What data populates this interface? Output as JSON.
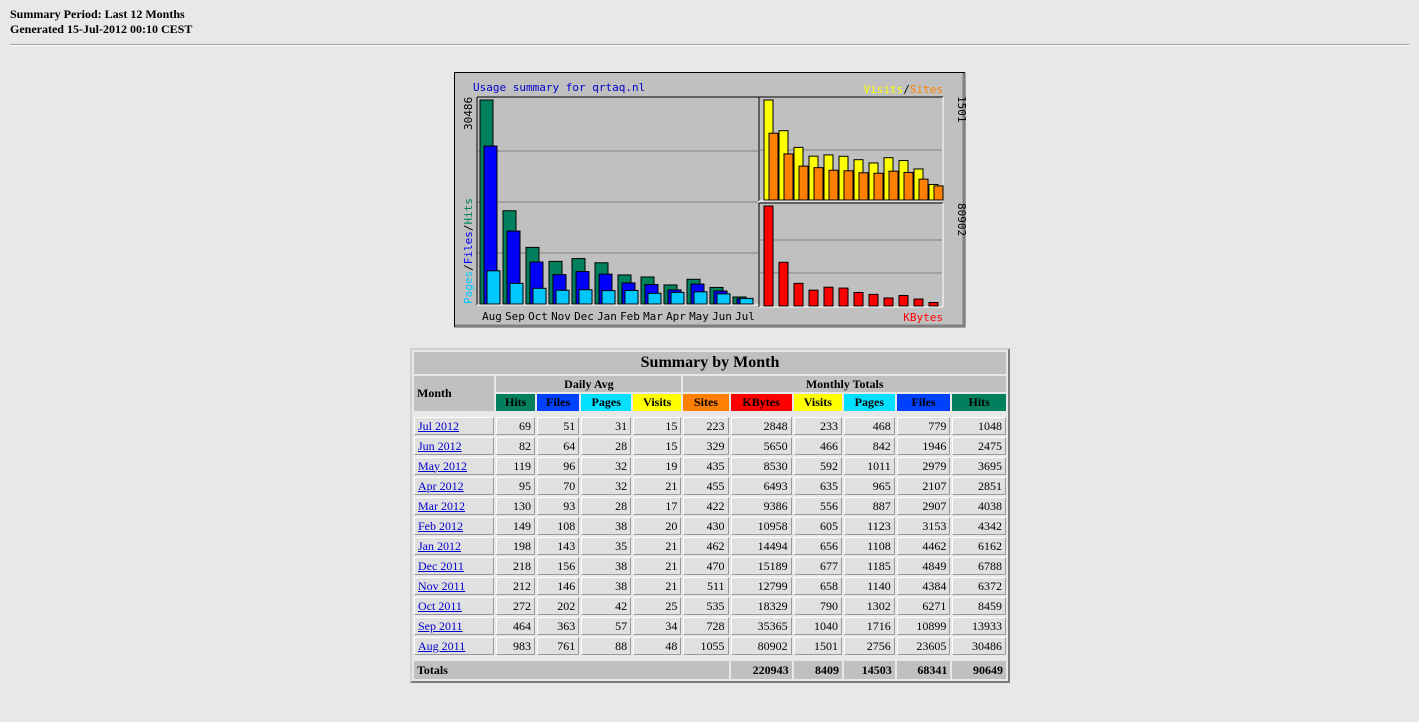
{
  "header": {
    "period": "Summary Period: Last 12 Months",
    "generated": "Generated 15-Jul-2012 00:10 CEST"
  },
  "graph": {
    "title": "Usage summary for qrtaq.nl",
    "left_axis_max": "30486",
    "left_legend": {
      "pages": "Pages",
      "files": "Files",
      "hits": "Hits",
      "sep": "/"
    },
    "visits_legend": "Visits",
    "sites_legend": "Sites",
    "visits_axis_max": "1501",
    "kbytes_axis_max": "80902",
    "kbytes_legend": "KBytes",
    "months": [
      "Aug",
      "Sep",
      "Oct",
      "Nov",
      "Dec",
      "Jan",
      "Feb",
      "Mar",
      "Apr",
      "May",
      "Jun",
      "Jul"
    ],
    "colors": {
      "hits": "#00805c",
      "files": "#0000ff",
      "pages": "#00c8ff",
      "visits": "#ffff00",
      "sites": "#ff8000",
      "kbytes": "#ff0000",
      "plot_bg": "#c0c0c0",
      "title": "#0000cc"
    }
  },
  "table": {
    "title": "Summary by Month",
    "month_header": "Month",
    "daily_avg_header": "Daily Avg",
    "monthly_totals_header": "Monthly Totals",
    "daily_cols": [
      "Hits",
      "Files",
      "Pages",
      "Visits"
    ],
    "monthly_cols": [
      "Sites",
      "KBytes",
      "Visits",
      "Pages",
      "Files",
      "Hits"
    ],
    "rows": [
      {
        "month": "Jul 2012",
        "d_hits": "69",
        "d_files": "51",
        "d_pages": "31",
        "d_visits": "15",
        "sites": "223",
        "kbytes": "2848",
        "visits": "233",
        "pages": "468",
        "files": "779",
        "hits": "1048"
      },
      {
        "month": "Jun 2012",
        "d_hits": "82",
        "d_files": "64",
        "d_pages": "28",
        "d_visits": "15",
        "sites": "329",
        "kbytes": "5650",
        "visits": "466",
        "pages": "842",
        "files": "1946",
        "hits": "2475"
      },
      {
        "month": "May 2012",
        "d_hits": "119",
        "d_files": "96",
        "d_pages": "32",
        "d_visits": "19",
        "sites": "435",
        "kbytes": "8530",
        "visits": "592",
        "pages": "1011",
        "files": "2979",
        "hits": "3695"
      },
      {
        "month": "Apr 2012",
        "d_hits": "95",
        "d_files": "70",
        "d_pages": "32",
        "d_visits": "21",
        "sites": "455",
        "kbytes": "6493",
        "visits": "635",
        "pages": "965",
        "files": "2107",
        "hits": "2851"
      },
      {
        "month": "Mar 2012",
        "d_hits": "130",
        "d_files": "93",
        "d_pages": "28",
        "d_visits": "17",
        "sites": "422",
        "kbytes": "9386",
        "visits": "556",
        "pages": "887",
        "files": "2907",
        "hits": "4038"
      },
      {
        "month": "Feb 2012",
        "d_hits": "149",
        "d_files": "108",
        "d_pages": "38",
        "d_visits": "20",
        "sites": "430",
        "kbytes": "10958",
        "visits": "605",
        "pages": "1123",
        "files": "3153",
        "hits": "4342"
      },
      {
        "month": "Jan 2012",
        "d_hits": "198",
        "d_files": "143",
        "d_pages": "35",
        "d_visits": "21",
        "sites": "462",
        "kbytes": "14494",
        "visits": "656",
        "pages": "1108",
        "files": "4462",
        "hits": "6162"
      },
      {
        "month": "Dec 2011",
        "d_hits": "218",
        "d_files": "156",
        "d_pages": "38",
        "d_visits": "21",
        "sites": "470",
        "kbytes": "15189",
        "visits": "677",
        "pages": "1185",
        "files": "4849",
        "hits": "6788"
      },
      {
        "month": "Nov 2011",
        "d_hits": "212",
        "d_files": "146",
        "d_pages": "38",
        "d_visits": "21",
        "sites": "511",
        "kbytes": "12799",
        "visits": "658",
        "pages": "1140",
        "files": "4384",
        "hits": "6372"
      },
      {
        "month": "Oct 2011",
        "d_hits": "272",
        "d_files": "202",
        "d_pages": "42",
        "d_visits": "25",
        "sites": "535",
        "kbytes": "18329",
        "visits": "790",
        "pages": "1302",
        "files": "6271",
        "hits": "8459"
      },
      {
        "month": "Sep 2011",
        "d_hits": "464",
        "d_files": "363",
        "d_pages": "57",
        "d_visits": "34",
        "sites": "728",
        "kbytes": "35365",
        "visits": "1040",
        "pages": "1716",
        "files": "10899",
        "hits": "13933"
      },
      {
        "month": "Aug 2011",
        "d_hits": "983",
        "d_files": "761",
        "d_pages": "88",
        "d_visits": "48",
        "sites": "1055",
        "kbytes": "80902",
        "visits": "1501",
        "pages": "2756",
        "files": "23605",
        "hits": "30486"
      }
    ],
    "totals": {
      "label": "Totals",
      "kbytes": "220943",
      "visits": "8409",
      "pages": "14503",
      "files": "68341",
      "hits": "90649"
    }
  },
  "chart_data": {
    "type": "bar",
    "title": "Usage summary for qrtaq.nl",
    "categories": [
      "Aug",
      "Sep",
      "Oct",
      "Nov",
      "Dec",
      "Jan",
      "Feb",
      "Mar",
      "Apr",
      "May",
      "Jun",
      "Jul"
    ],
    "series": [
      {
        "name": "Hits",
        "values": [
          30486,
          13933,
          8459,
          6372,
          6788,
          6162,
          4342,
          4038,
          2851,
          3695,
          2475,
          1048
        ]
      },
      {
        "name": "Files",
        "values": [
          23605,
          10899,
          6271,
          4384,
          4849,
          4462,
          3153,
          2907,
          2107,
          2979,
          1946,
          779
        ]
      },
      {
        "name": "Pages",
        "values": [
          2756,
          1716,
          1302,
          1140,
          1185,
          1108,
          1123,
          887,
          965,
          1011,
          842,
          468
        ]
      },
      {
        "name": "Visits",
        "values": [
          1501,
          1040,
          790,
          658,
          677,
          656,
          605,
          556,
          635,
          592,
          466,
          233
        ]
      },
      {
        "name": "Sites",
        "values": [
          1055,
          728,
          535,
          511,
          470,
          462,
          430,
          422,
          455,
          435,
          329,
          223
        ]
      },
      {
        "name": "KBytes",
        "values": [
          80902,
          35365,
          18329,
          12799,
          15189,
          14494,
          10958,
          9386,
          6493,
          8530,
          5650,
          2848
        ]
      }
    ],
    "ylim_hits": [
      0,
      30486
    ],
    "ylim_visits": [
      0,
      1501
    ],
    "ylim_kbytes": [
      0,
      80902
    ],
    "grid": true
  }
}
